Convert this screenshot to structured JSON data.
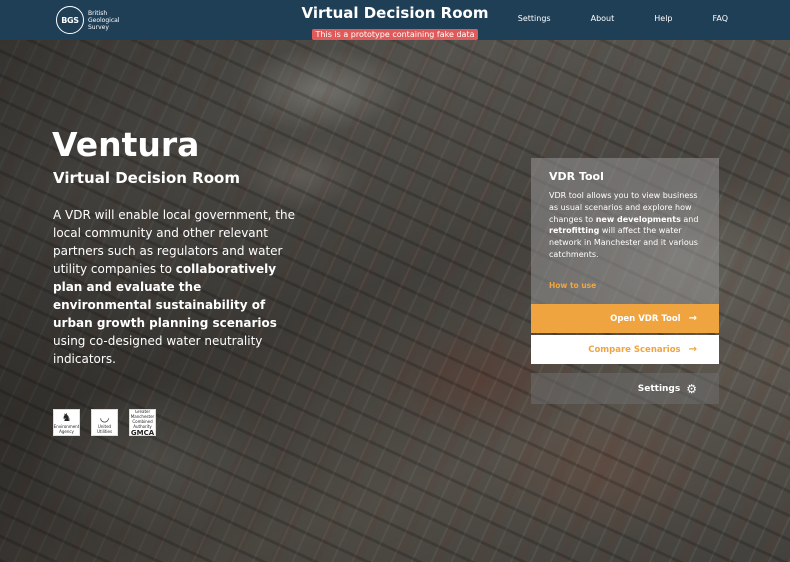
{
  "header": {
    "logo_mark": "BGS",
    "logo_text": "British Geological Survey",
    "title": "Virtual Decision Room",
    "prototype_badge": "This is a prototype containing fake data",
    "nav": [
      "Settings",
      "About",
      "Help",
      "FAQ"
    ]
  },
  "hero": {
    "title": "Ventura",
    "subtitle": "Virtual Decision Room",
    "desc_1": "A VDR will enable local government, the local community and other relevant partners such as regulators and water utility companies to ",
    "desc_bold_1": "collaboratively plan and evaluate the environmental sustainability of urban growth planning scenarios",
    "desc_2": " using co-designed water neutrality indicators."
  },
  "partners": [
    {
      "name": "Environment Agency",
      "glyph": "♞"
    },
    {
      "name": "United Utilities",
      "glyph": "◡"
    },
    {
      "name": "Greater Manchester Combined Authority",
      "glyph": "GMCA"
    }
  ],
  "panel": {
    "title": "VDR Tool",
    "desc_1": "VDR tool allows you to view business as usual scenarios and explore how changes to ",
    "desc_bold_1": "new developments",
    "desc_2": " and ",
    "desc_bold_2": "retrofitting",
    "desc_3": " will affect the water network in Manchester and it various catchments.",
    "how_to_use": "How to use"
  },
  "buttons": {
    "open_label": "Open VDR Tool",
    "compare_label": "Compare Scenarios",
    "settings_label": "Settings",
    "arrow_icon": "→",
    "gear_icon": "⚙"
  },
  "colors": {
    "header_bg": "#1f3f57",
    "accent": "#f0a440",
    "badge": "#e05a5a"
  }
}
